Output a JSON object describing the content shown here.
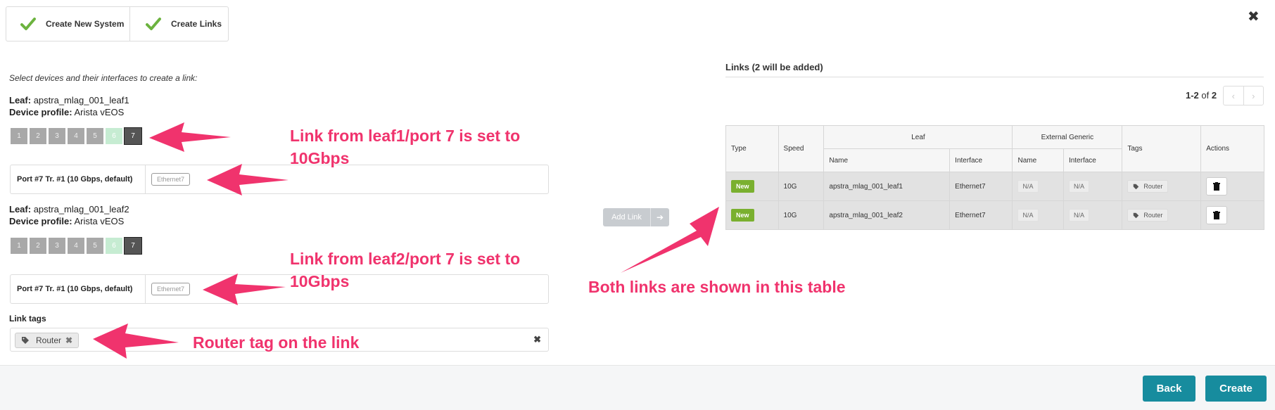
{
  "wizard": {
    "steps": [
      {
        "label": "Create New System"
      },
      {
        "label": "Create Links"
      }
    ]
  },
  "form": {
    "instructions": "Select devices and their interfaces to create a link:",
    "devices": [
      {
        "role_label": "Leaf:",
        "name": "apstra_mlag_001_leaf1",
        "profile_label": "Device profile:",
        "profile": "Arista vEOS",
        "ports": [
          "1",
          "2",
          "3",
          "4",
          "5",
          "6",
          "7"
        ],
        "selected_port": "7",
        "port_row_label": "Port #7 Tr. #1 (10 Gbps, default)",
        "interface": "Ethernet7"
      },
      {
        "role_label": "Leaf:",
        "name": "apstra_mlag_001_leaf2",
        "profile_label": "Device profile:",
        "profile": "Arista vEOS",
        "ports": [
          "1",
          "2",
          "3",
          "4",
          "5",
          "6",
          "7"
        ],
        "selected_port": "7",
        "port_row_label": "Port #7 Tr. #1 (10 Gbps, default)",
        "interface": "Ethernet7"
      }
    ],
    "link_tags_label": "Link tags",
    "tags": [
      "Router"
    ]
  },
  "add_link": {
    "label": "Add Link"
  },
  "links": {
    "title": "Links (2 will be added)",
    "pagination": {
      "range": "1-2",
      "of_label": "of",
      "total": "2"
    },
    "headers": {
      "type": "Type",
      "speed": "Speed",
      "leaf": "Leaf",
      "external": "External Generic",
      "tags": "Tags",
      "actions": "Actions",
      "name": "Name",
      "interface": "Interface"
    },
    "rows": [
      {
        "type": "New",
        "speed": "10G",
        "leaf_name": "apstra_mlag_001_leaf1",
        "leaf_interface": "Ethernet7",
        "ext_name": "N/A",
        "ext_interface": "N/A",
        "tag": "Router"
      },
      {
        "type": "New",
        "speed": "10G",
        "leaf_name": "apstra_mlag_001_leaf2",
        "leaf_interface": "Ethernet7",
        "ext_name": "N/A",
        "ext_interface": "N/A",
        "tag": "Router"
      }
    ]
  },
  "annotations": {
    "leaf1_line1": "Link from leaf1/port 7 is set to",
    "leaf1_line2": "10Gbps",
    "leaf2_line1": "Link from leaf2/port 7 is set to",
    "leaf2_line2": "10Gbps",
    "table": "Both links are shown in this table",
    "tag": "Router tag on the link"
  },
  "footer": {
    "back": "Back",
    "create": "Create"
  },
  "colors": {
    "accent": "#178c9e",
    "new_badge": "#7ab02f",
    "annotation": "#f0336d"
  }
}
